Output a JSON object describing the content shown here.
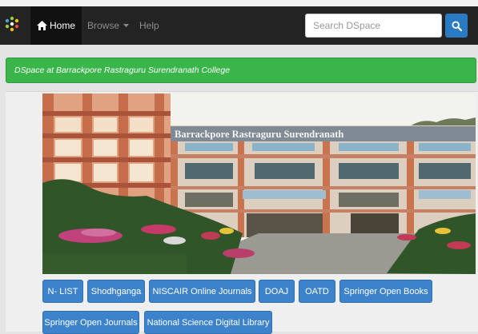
{
  "navbar": {
    "home_label": "Home",
    "browse_label": "Browse",
    "help_label": "Help",
    "search_placeholder": "Search DSpace",
    "colors": {
      "background": "#232323",
      "active": "#111111",
      "search_button": "#2a7ac4"
    }
  },
  "banner": {
    "text": "DSpace at Barrackpore Rastraguru Surendranath College",
    "color": "#3ab54a"
  },
  "photo": {
    "sign_text": "Barrackpore Rastraguru Surendranath"
  },
  "links": [
    {
      "label": "N- LIST"
    },
    {
      "label": "Shodhganga"
    },
    {
      "label": "NISCAIR Online Journals"
    },
    {
      "label": "DOAJ"
    },
    {
      "label": "OATD"
    },
    {
      "label": "Springer Open Books"
    },
    {
      "label": "Springer Open Journals"
    },
    {
      "label": "National Science Digital Library"
    }
  ],
  "icons": [
    "dspace-logo-icon",
    "home-icon",
    "caret-down-icon",
    "search-icon"
  ]
}
